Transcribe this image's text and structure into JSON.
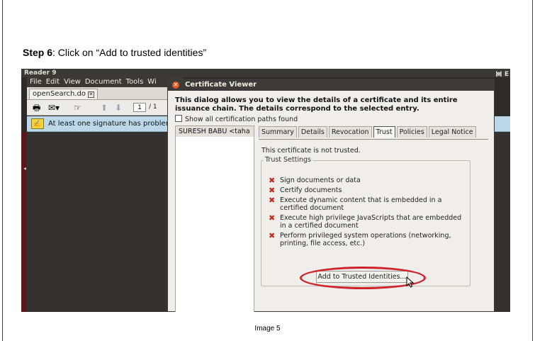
{
  "step": {
    "bold": "Step 6",
    "text": ": Click on “Add to trusted identities”"
  },
  "reader": {
    "title": "Reader 9",
    "menu": [
      "File",
      "Edit",
      "View",
      "Document",
      "Tools",
      "Wi"
    ],
    "doc_tab": "openSearch.do",
    "page_current": "1",
    "page_total": "/ 1",
    "signature_warning": "At least one signature has problems"
  },
  "dialog": {
    "title": "Certificate Viewer",
    "intro": "This dialog allows you to view the details of a certificate and its entire issuance chain. The details correspond to the selected entry.",
    "show_all_label": "Show all certification paths found",
    "entry": "SURESH BABU <taha",
    "tabs": [
      "Summary",
      "Details",
      "Revocation",
      "Trust",
      "Policies",
      "Legal Notice"
    ],
    "active_tab": "Trust",
    "not_trusted": "This certificate is not trusted.",
    "trust_settings_label": "Trust Settings",
    "trust_items": [
      "Sign documents or data",
      "Certify documents",
      "Execute dynamic content that is embedded in a certified document",
      "Execute high privilege JavaScripts that are embedded in a certified document",
      "Perform privileged system operations (networking, printing, file access, etc.)"
    ],
    "add_button": "Add to Trusted Identities..."
  },
  "caption": "Image 5",
  "colors": {
    "highlight_oval": "#d0242c",
    "x_mark": "#c42a20",
    "signature_bar": "#bcd8e8"
  }
}
